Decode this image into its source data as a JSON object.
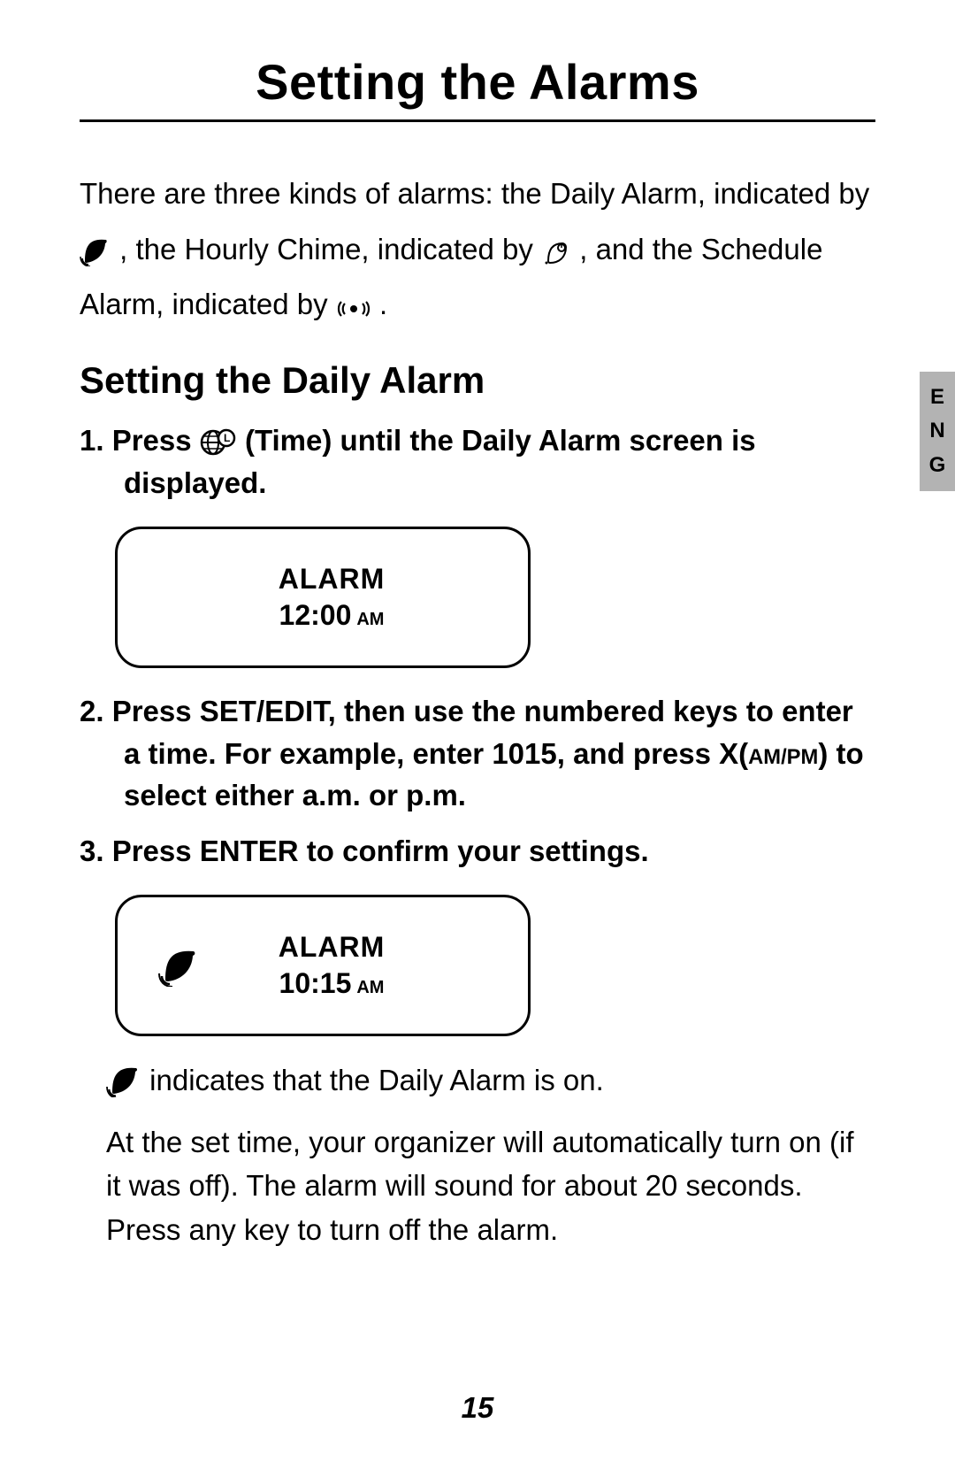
{
  "title": "Setting the Alarms",
  "intro": {
    "part1": "There are three kinds of alarms: the Daily Alarm, indicated by ",
    "part2": ", the Hourly Chime, indicated by ",
    "part3": ", and the Schedule Alarm, indicated by ",
    "part4": "."
  },
  "subhead": "Setting the Daily Alarm",
  "steps": {
    "s1_prefix": "1.  Press ",
    "s1_time_label": "(Time)",
    "s1_suffix": " until the Daily Alarm screen is displayed.",
    "s2_part1": "2.  Press SET/EDIT, then use the numbered keys to enter a time. For example, enter 1015, and press X(",
    "s2_ampm": "AM/PM",
    "s2_part2": ") to select either a.m. or p.m.",
    "s3": "3.  Press ENTER to confirm your settings."
  },
  "lcd1": {
    "label": "ALARM",
    "time": "12:00",
    "ampm": "AM"
  },
  "lcd2": {
    "label": "ALARM",
    "time": "10:15",
    "ampm": "AM"
  },
  "notes": {
    "on_note": " indicates that the Daily Alarm is on.",
    "para": "At the set time, your organizer will automatically turn on (if it was off). The alarm will sound for about 20 seconds. Press any key to turn off the alarm."
  },
  "page_number": "15",
  "lang_tab": "ENG"
}
